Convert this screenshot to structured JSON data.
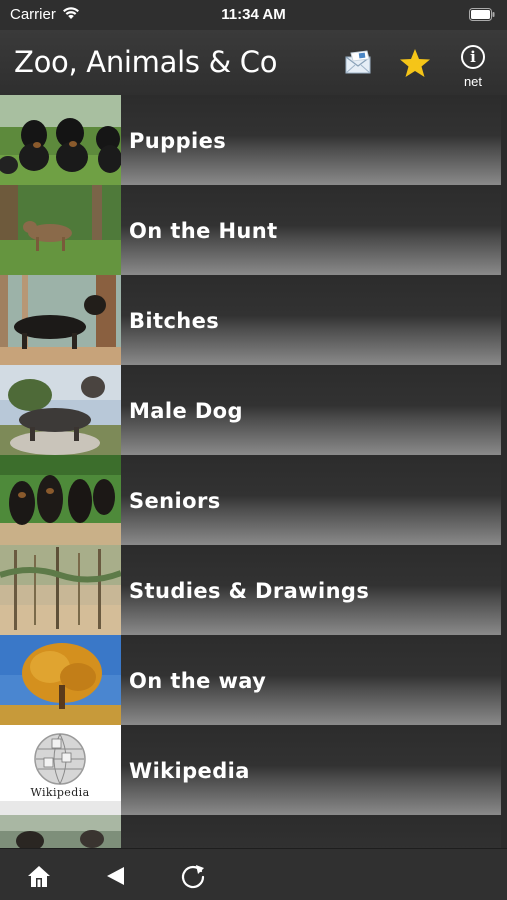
{
  "status_bar": {
    "carrier": "Carrier",
    "time": "11:34 AM"
  },
  "nav": {
    "title": "Zoo, Animals & Co",
    "mail_icon": "mail-icon",
    "star_icon": "star-icon",
    "star_color": "#f5c518",
    "info_glyph": "i",
    "info_caption": "net"
  },
  "list": {
    "items": [
      {
        "label": "Puppies",
        "thumb": "puppies-photo"
      },
      {
        "label": "On the Hunt",
        "thumb": "hunt-photo"
      },
      {
        "label": "Bitches",
        "thumb": "bitch-photo"
      },
      {
        "label": "Male Dog",
        "thumb": "male-dog-photo"
      },
      {
        "label": "Seniors",
        "thumb": "seniors-photo"
      },
      {
        "label": "Studies & Drawings",
        "thumb": "drawing-photo"
      },
      {
        "label": "On the way",
        "thumb": "tree-photo"
      },
      {
        "label": "Wikipedia",
        "thumb": "wikipedia-logo",
        "logo_text": "Wikipedia"
      },
      {
        "label": "",
        "thumb": "partial-photo"
      }
    ]
  },
  "tab_bar": {
    "home_icon": "home-icon",
    "back_icon": "back-arrow-icon",
    "reload_icon": "reload-icon"
  }
}
